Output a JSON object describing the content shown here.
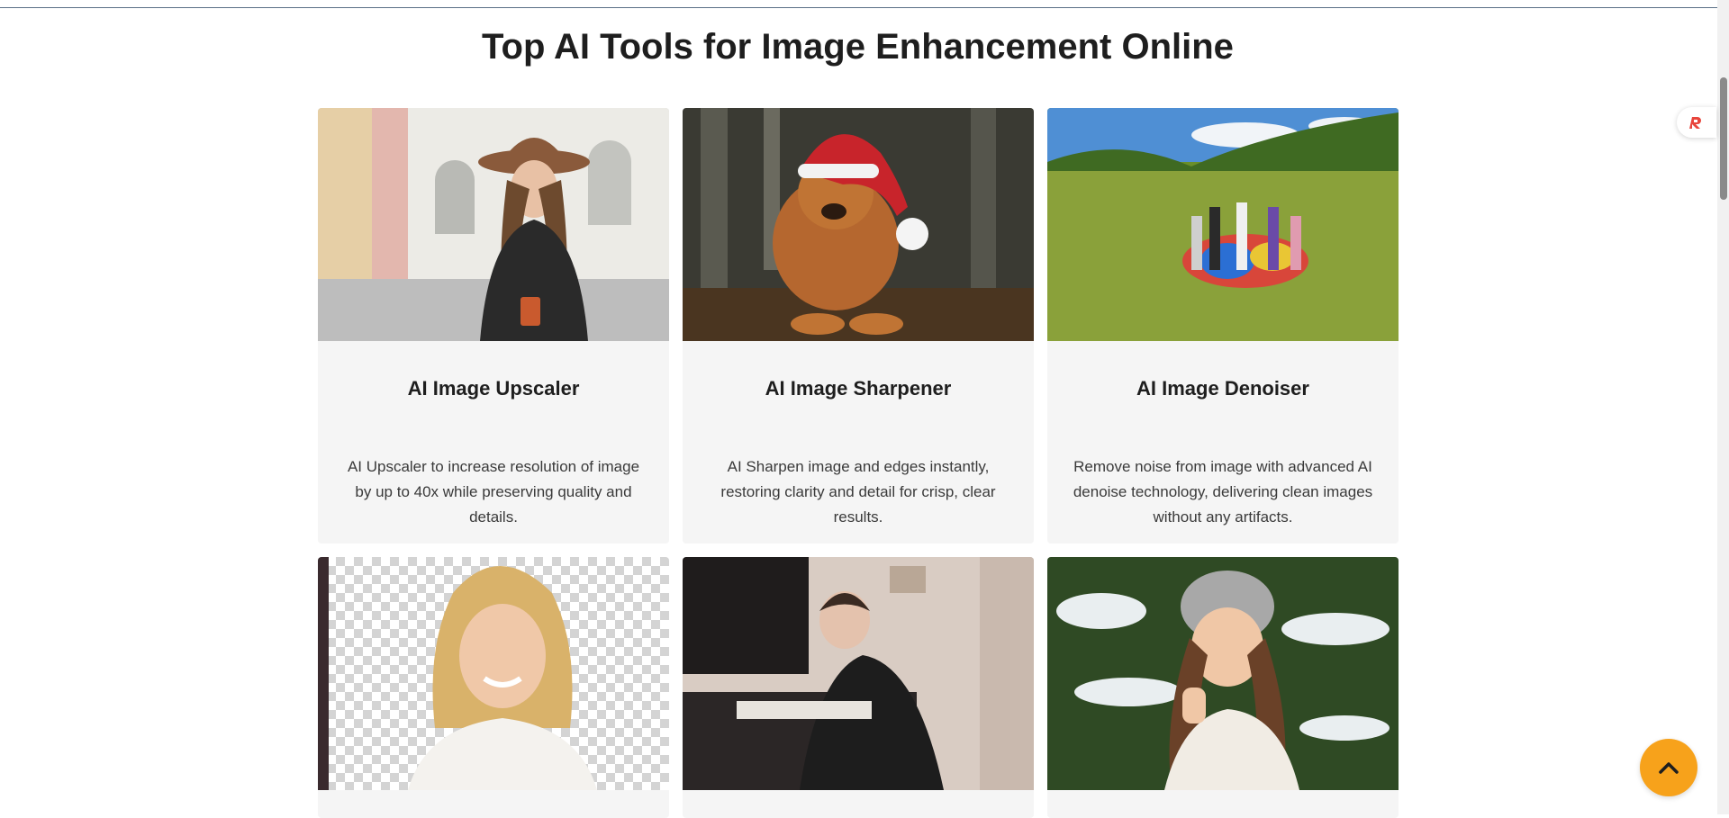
{
  "section": {
    "title": "Top AI Tools for Image Enhancement Online"
  },
  "cards": [
    {
      "title": "AI Image Upscaler",
      "description": "AI Upscaler to increase resolution of image by up to 40x while preserving quality and details.",
      "image_icon": "woman-hat-photo"
    },
    {
      "title": "AI Image Sharpener",
      "description": "AI Sharpen image and edges instantly, restoring clarity and detail for crisp, clear results.",
      "image_icon": "dog-santa-hat-photo"
    },
    {
      "title": "AI Image Denoiser",
      "description": "Remove noise from image with advanced AI denoise technology, delivering clean images without any artifacts.",
      "image_icon": "children-field-photo"
    },
    {
      "title": "",
      "description": "",
      "image_icon": "woman-transparent-background-photo"
    },
    {
      "title": "",
      "description": "",
      "image_icon": "boy-desk-colorized-photo"
    },
    {
      "title": "",
      "description": "",
      "image_icon": "girl-winter-thumbs-up-photo"
    }
  ],
  "widgets": {
    "side_icon": "r-logo-icon",
    "back_to_top_icon": "chevron-up-icon"
  },
  "colors": {
    "accent": "#f7a21b",
    "card_bg": "#f5f5f5",
    "widget_logo": "#e8453c"
  }
}
